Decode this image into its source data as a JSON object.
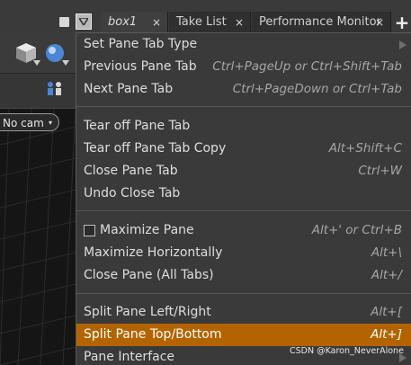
{
  "tabs": [
    {
      "label": "box1",
      "active": true
    },
    {
      "label": "Take List",
      "active": false
    },
    {
      "label": "Performance Monitor",
      "active": false
    }
  ],
  "tab_close_glyph": "×",
  "new_tab_glyph": "+",
  "viewport": {
    "camera_label": "No cam"
  },
  "menu": {
    "items": [
      {
        "label": "Set Pane Tab Type",
        "shortcut": "",
        "submenu": true
      },
      {
        "label": "Previous Pane Tab",
        "shortcut": "Ctrl+PageUp or Ctrl+Shift+Tab"
      },
      {
        "label": "Next Pane Tab",
        "shortcut": "Ctrl+PageDown or Ctrl+Tab"
      },
      {
        "label": "Tear off Pane Tab",
        "shortcut": ""
      },
      {
        "label": "Tear off Pane Tab Copy",
        "shortcut": "Alt+Shift+C"
      },
      {
        "label": "Close Pane Tab",
        "shortcut": "Ctrl+W"
      },
      {
        "label": "Undo Close Tab",
        "shortcut": ""
      },
      {
        "label": "Maximize Pane",
        "shortcut": "Alt+' or Ctrl+B",
        "checkbox": true,
        "checked": false
      },
      {
        "label": "Maximize Horizontally",
        "shortcut": "Alt+\\"
      },
      {
        "label": "Close Pane (All Tabs)",
        "shortcut": "Alt+/"
      },
      {
        "label": "Split Pane Left/Right",
        "shortcut": "Alt+["
      },
      {
        "label": "Split Pane Top/Bottom",
        "shortcut": "Alt+]",
        "highlighted": true
      },
      {
        "label": "Pane Interface",
        "shortcut": "",
        "submenu": true
      }
    ]
  },
  "watermark": "CSDN @Karon_NeverAlone",
  "colors": {
    "menu_bg": "#3a3a3a",
    "highlight": "#b36400",
    "tabbar_bg": "#3a3a3a",
    "text": "#dedede",
    "shortcut_text": "#a6a6a6"
  },
  "icons": [
    "pane-square-icon",
    "tab-menu-arrow-icon",
    "geometry-cube-icon",
    "sphere-icon",
    "people-icon",
    "submenu-arrow-icon"
  ]
}
